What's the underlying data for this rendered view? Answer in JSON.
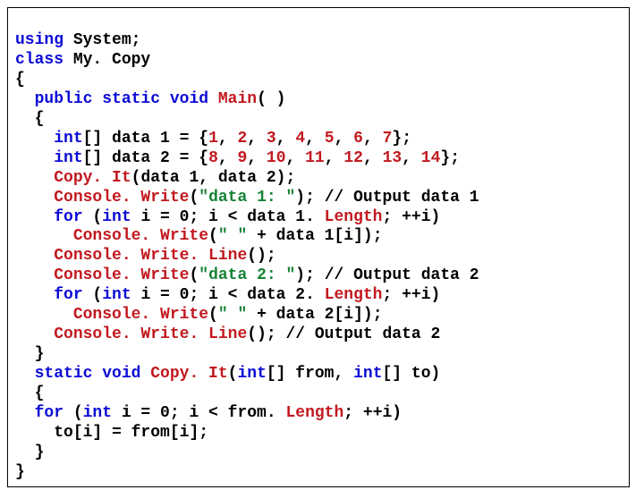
{
  "code": {
    "l01_using": "using",
    "l01_system": " System;",
    "l02_class": "class",
    "l02_name": " My. Copy",
    "l03_brace": "{",
    "l04_mods": "public static void",
    "l04_main": " Main",
    "l04_paren": "( )",
    "l05_brace": "{",
    "l06_int": "int",
    "l06_decl": "[] data 1 = {",
    "l06_n1": "1",
    "l06_n2": "2",
    "l06_n3": "3",
    "l06_n4": "4",
    "l06_n5": "5",
    "l06_n6": "6",
    "l06_n7": "7",
    "l06_end": "};",
    "l07_int": "int",
    "l07_decl": "[] data 2 = {",
    "l07_n1": "8",
    "l07_n2": "9",
    "l07_n3": "10",
    "l07_n4": "11",
    "l07_n5": "12",
    "l07_n6": "13",
    "l07_n7": "14",
    "l07_end": "};",
    "l08_copyit": "Copy. It",
    "l08_args": "(data 1, data 2);",
    "l09_cw": "Console. Write",
    "l09_open": "(",
    "l09_str": "\"data 1: \"",
    "l09_close": "); // Output data 1",
    "l10_for": "for",
    "l10_open": " (",
    "l10_int": "int",
    "l10_rest": " i = 0; i < data 1.",
    "l10_len": " Length",
    "l10_end": "; ++i)",
    "l11_cw": "Console. Write",
    "l11_open": "(",
    "l11_str": "\" \"",
    "l11_close": " + data 1[i]);",
    "l12_cwl": "Console. Write. Line",
    "l12_close": "();",
    "l13_cw": "Console. Write",
    "l13_open": "(",
    "l13_str": "\"data 2: \"",
    "l13_close": "); // Output data 2",
    "l14_for": "for",
    "l14_open": " (",
    "l14_int": "int",
    "l14_rest": " i = 0; i < data 2.",
    "l14_len": " Length",
    "l14_end": "; ++i)",
    "l15_cw": "Console. Write",
    "l15_open": "(",
    "l15_str": "\" \"",
    "l15_close": " + data 2[i]);",
    "l16_cwl": "Console. Write. Line",
    "l16_close": "(); // Output data 2",
    "l17_brace": "}",
    "l18_mods": "static void",
    "l18_copyit": " Copy. It",
    "l18_open": "(",
    "l18_int1": "int",
    "l18_p1": "[] from, ",
    "l18_int2": "int",
    "l18_p2": "[] to)",
    "l19_brace": "{",
    "l20_for": "for",
    "l20_open": " (",
    "l20_int": "int",
    "l20_rest": " i = 0; i < from.",
    "l20_len": " Length",
    "l20_end": "; ++i)",
    "l21_body": "to[i] = from[i];",
    "l22_brace": "}",
    "l23_brace": "}"
  },
  "sep": ", "
}
